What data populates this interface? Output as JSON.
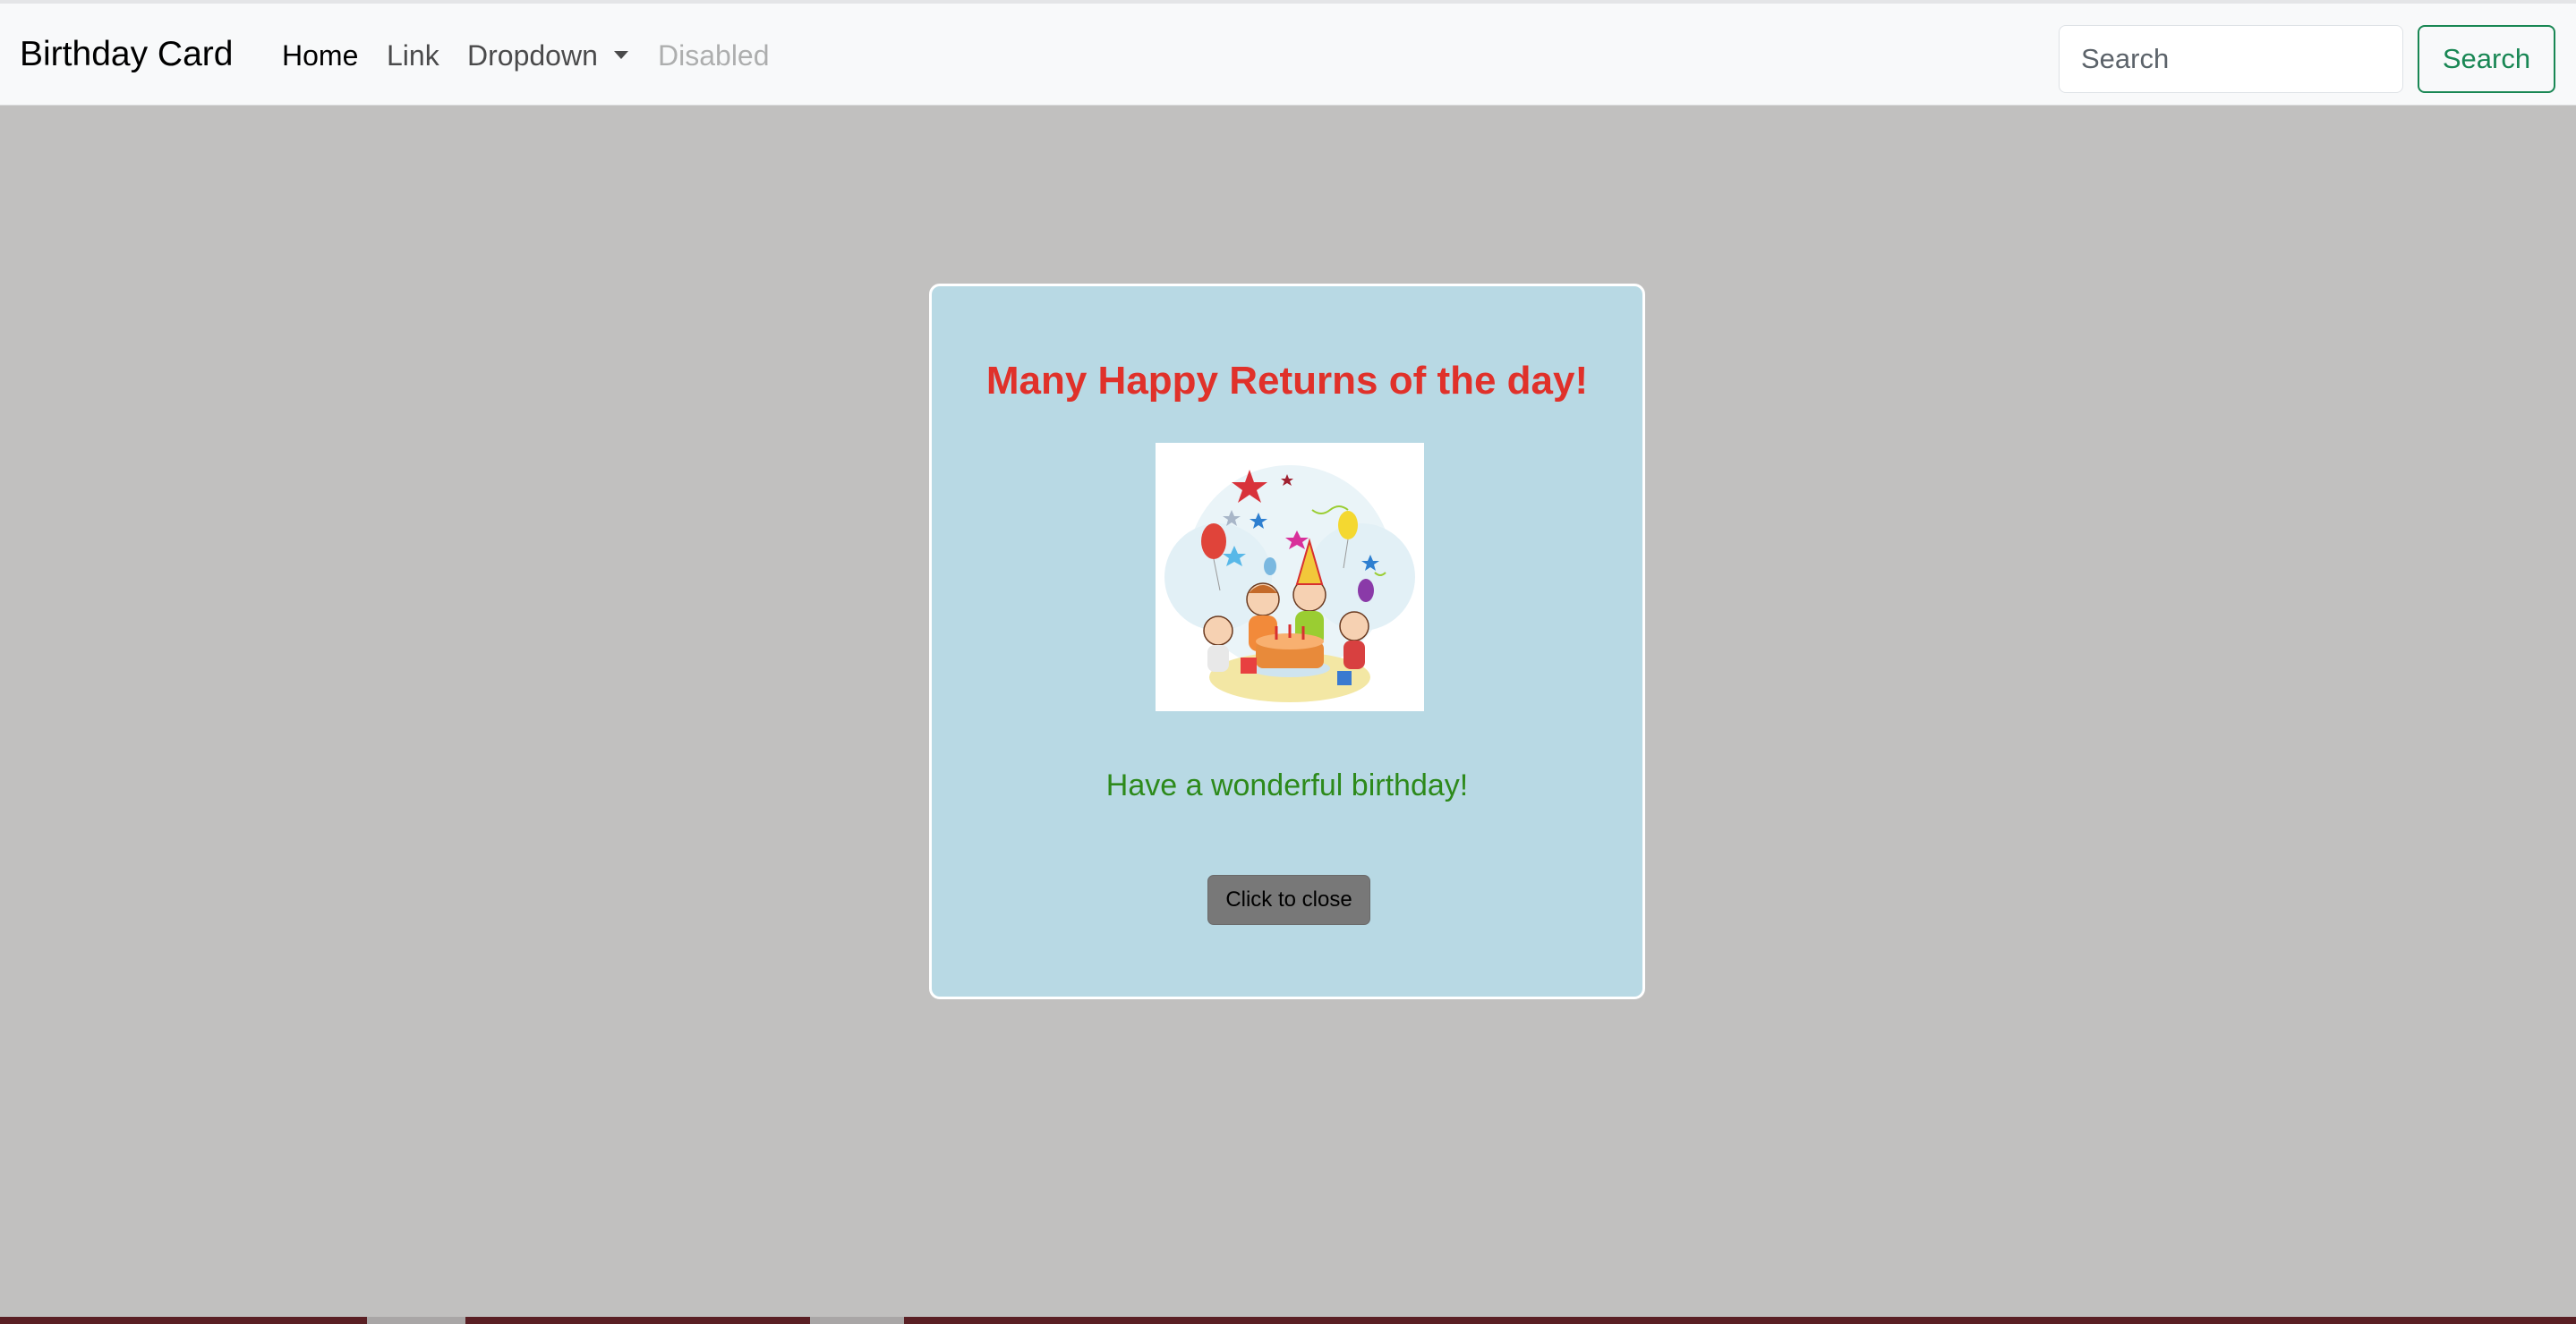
{
  "navbar": {
    "brand": "Birthday Card",
    "links": {
      "home": "Home",
      "link": "Link",
      "dropdown": "Dropdown",
      "disabled": "Disabled"
    },
    "search": {
      "placeholder": "Search",
      "button_label": "Search"
    }
  },
  "card": {
    "title": "Many Happy Returns of the day!",
    "image_icon": "birthday-party-illustration",
    "message": "Have a wonderful birthday!",
    "close_label": "Click to close"
  },
  "colors": {
    "background": "#c1c0bf",
    "card_background": "#b8d9e4",
    "title": "#e0312a",
    "message": "#2d8a1b",
    "search_button": "#198754"
  }
}
